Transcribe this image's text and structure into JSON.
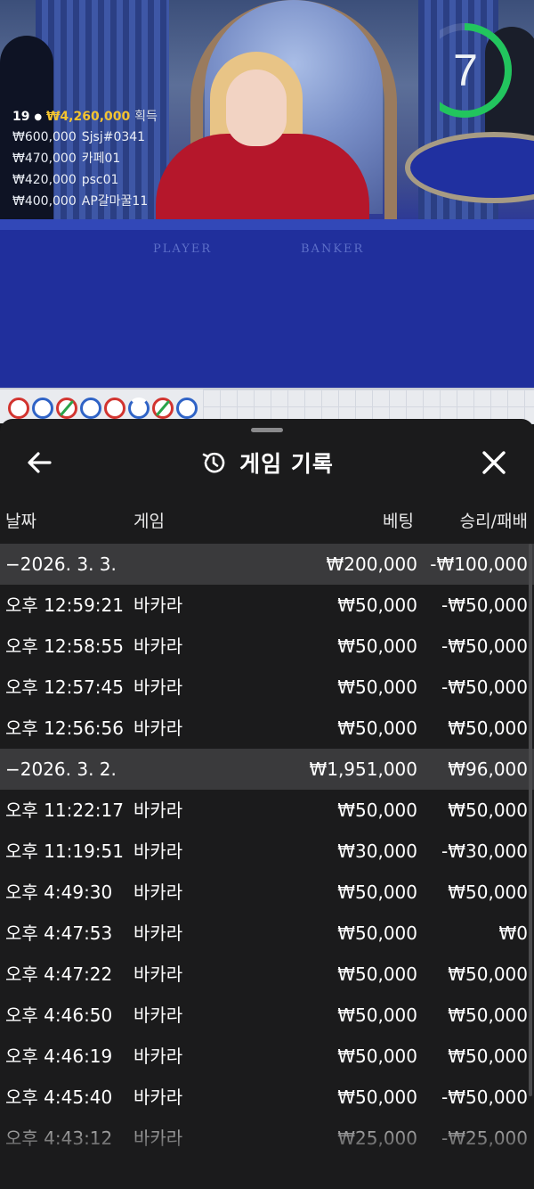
{
  "live": {
    "winners_count": "19",
    "total_won": "₩4,260,000",
    "won_label": "획득",
    "winners": [
      {
        "amount": "₩600,000",
        "name": "Sjsj#0341"
      },
      {
        "amount": "₩470,000",
        "name": "카페01"
      },
      {
        "amount": "₩420,000",
        "name": "psc01"
      },
      {
        "amount": "₩400,000",
        "name": "AP갈마꿀11"
      }
    ],
    "timer": "7",
    "timer_progress": 0.65,
    "table_labels": {
      "player": "PLAYER",
      "banker": "BANKER"
    }
  },
  "road": {
    "beads": [
      {
        "color": "#d2342f",
        "mark": "none"
      },
      {
        "color": "#2f63c6",
        "mark": "none"
      },
      {
        "color": "#d2342f",
        "mark": "slash"
      },
      {
        "color": "#2f63c6",
        "mark": "none"
      },
      {
        "color": "#d2342f",
        "mark": "none"
      },
      {
        "color": "#2f63c6",
        "mark": "dot"
      },
      {
        "color": "#d2342f",
        "mark": "slash"
      },
      {
        "color": "#2f63c6",
        "mark": "none"
      }
    ]
  },
  "history": {
    "title": "게임 기록",
    "back_icon": "arrow-left-icon",
    "history_icon": "history-clock-icon",
    "close_icon": "close-icon",
    "columns": {
      "date": "날짜",
      "game": "게임",
      "bet": "베팅",
      "result": "승리/패배"
    },
    "rows": [
      {
        "type": "day",
        "date": "−2026. 3. 3.",
        "game": "",
        "bet": "₩200,000",
        "result": "-₩100,000"
      },
      {
        "type": "entry",
        "date": "오후 12:59:21",
        "game": "바카라",
        "bet": "₩50,000",
        "result": "-₩50,000"
      },
      {
        "type": "entry",
        "date": "오후 12:58:55",
        "game": "바카라",
        "bet": "₩50,000",
        "result": "-₩50,000"
      },
      {
        "type": "entry",
        "date": "오후 12:57:45",
        "game": "바카라",
        "bet": "₩50,000",
        "result": "-₩50,000"
      },
      {
        "type": "entry",
        "date": "오후 12:56:56",
        "game": "바카라",
        "bet": "₩50,000",
        "result": "₩50,000"
      },
      {
        "type": "day",
        "date": "−2026. 3. 2.",
        "game": "",
        "bet": "₩1,951,000",
        "result": "₩96,000"
      },
      {
        "type": "entry",
        "date": "오후 11:22:17",
        "game": "바카라",
        "bet": "₩50,000",
        "result": "₩50,000"
      },
      {
        "type": "entry",
        "date": "오후 11:19:51",
        "game": "바카라",
        "bet": "₩30,000",
        "result": "-₩30,000"
      },
      {
        "type": "entry",
        "date": "오후 4:49:30",
        "game": "바카라",
        "bet": "₩50,000",
        "result": "₩50,000"
      },
      {
        "type": "entry",
        "date": "오후 4:47:53",
        "game": "바카라",
        "bet": "₩50,000",
        "result": "₩0"
      },
      {
        "type": "entry",
        "date": "오후 4:47:22",
        "game": "바카라",
        "bet": "₩50,000",
        "result": "₩50,000"
      },
      {
        "type": "entry",
        "date": "오후 4:46:50",
        "game": "바카라",
        "bet": "₩50,000",
        "result": "₩50,000"
      },
      {
        "type": "entry",
        "date": "오후 4:46:19",
        "game": "바카라",
        "bet": "₩50,000",
        "result": "₩50,000"
      },
      {
        "type": "entry",
        "date": "오후 4:45:40",
        "game": "바카라",
        "bet": "₩50,000",
        "result": "-₩50,000"
      },
      {
        "type": "entry",
        "date": "오후 4:43:12",
        "game": "바카라",
        "bet": "₩25,000",
        "result": "-₩25,000"
      }
    ]
  },
  "colors": {
    "sheet_bg": "#1b1b1c",
    "day_row_bg": "#3a3a3c",
    "timer_green": "#22c55e",
    "gold": "#f4c430"
  }
}
